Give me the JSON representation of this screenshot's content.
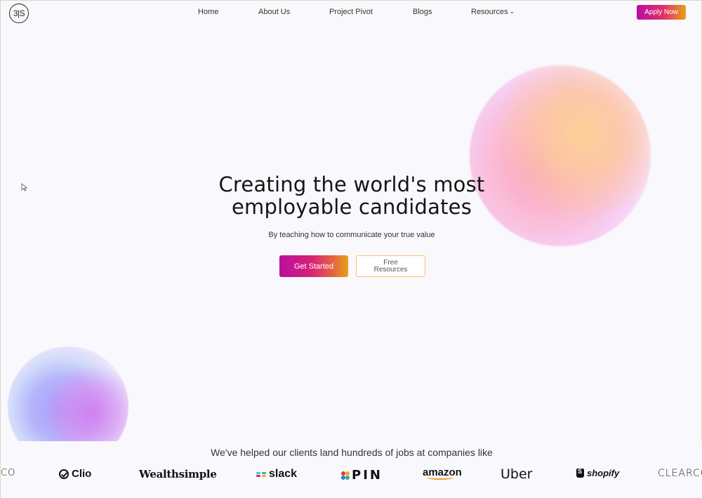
{
  "brand": {
    "logo_text": "3|S"
  },
  "nav": {
    "items": [
      {
        "label": "Home"
      },
      {
        "label": "About Us"
      },
      {
        "label": "Project Pivot"
      },
      {
        "label": "Blogs"
      },
      {
        "label": "Resources"
      }
    ],
    "apply_label": "Apply Now"
  },
  "hero": {
    "title_line1": "Creating the world's most",
    "title_line2": "employable candidates",
    "subtitle": "By teaching how to communicate your true value",
    "primary_cta": "Get Started",
    "secondary_cta": "Free Resources"
  },
  "clients": {
    "heading": "We've helped our clients land hundreds of jobs at companies like",
    "logos": [
      "CO",
      "Clio",
      "Wealthsimple",
      "slack",
      "PIN",
      "amazon",
      "Uber",
      "shopify",
      "CLEARCO"
    ]
  },
  "colors": {
    "accent_magenta": "#b8109e",
    "accent_orange": "#e8a118",
    "secondary_border": "#f2c76b",
    "background": "#f9f8fc"
  },
  "icons": {
    "resources_chevron": "chevron-down-icon",
    "cursor": "mouse-pointer-icon"
  }
}
